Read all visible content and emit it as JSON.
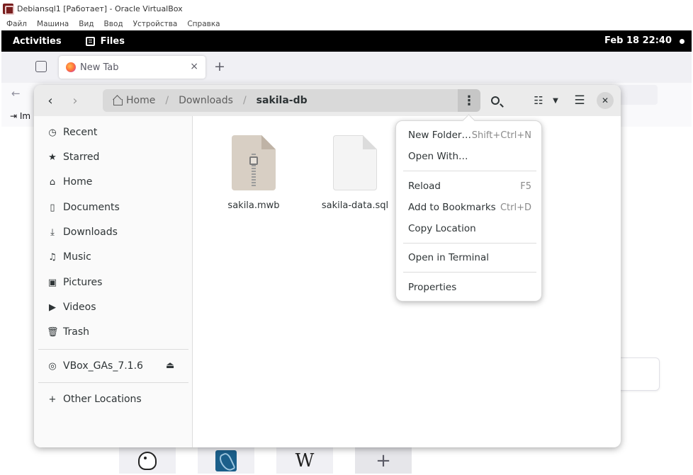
{
  "vbox": {
    "title": "Debiansql1 [Работает] - Oracle VirtualBox",
    "menu": [
      "Файл",
      "Машина",
      "Вид",
      "Ввод",
      "Устройства",
      "Справка"
    ]
  },
  "topbar": {
    "activities": "Activities",
    "app_name": "Files",
    "clock": "Feb 18  22:40"
  },
  "firefox": {
    "tab_title": "New Tab",
    "tab_close": "×",
    "new_tab": "+",
    "back": "←",
    "bookmark_import": "Im",
    "shortcut_wikipedia": "W",
    "shortcut_add": "+"
  },
  "dialog": {
    "path": [
      "Home",
      "/",
      "Downloads",
      "/",
      "sakila-db"
    ],
    "sidebar": [
      {
        "icon": "clock-icon",
        "label": "Recent"
      },
      {
        "icon": "star-icon",
        "label": "Starred"
      },
      {
        "icon": "home-icon",
        "label": "Home"
      },
      {
        "icon": "document-icon",
        "label": "Documents"
      },
      {
        "icon": "download-icon",
        "label": "Downloads"
      },
      {
        "icon": "music-icon",
        "label": "Music"
      },
      {
        "icon": "picture-icon",
        "label": "Pictures"
      },
      {
        "icon": "video-icon",
        "label": "Videos"
      },
      {
        "icon": "trash-icon",
        "label": "Trash"
      }
    ],
    "mounted_drive": {
      "icon": "disc-icon",
      "label": "VBox_GAs_7.1.6"
    },
    "other_locations": {
      "icon": "plus-icon",
      "label": "Other Locations"
    },
    "files": [
      {
        "name": "sakila.mwb",
        "type": "archive"
      },
      {
        "name": "sakila-data.sql",
        "type": "text"
      }
    ]
  },
  "popover_menu": {
    "items": [
      {
        "label": "New Folder…",
        "accel": "Shift+Ctrl+N"
      },
      {
        "label": "Open With…",
        "accel": ""
      },
      {
        "label": "Reload",
        "accel": "F5"
      },
      {
        "label": "Add to Bookmarks",
        "accel": "Ctrl+D"
      },
      {
        "label": "Copy Location",
        "accel": ""
      },
      {
        "label": "Open in Terminal",
        "accel": ""
      },
      {
        "label": "Properties",
        "accel": ""
      }
    ]
  }
}
